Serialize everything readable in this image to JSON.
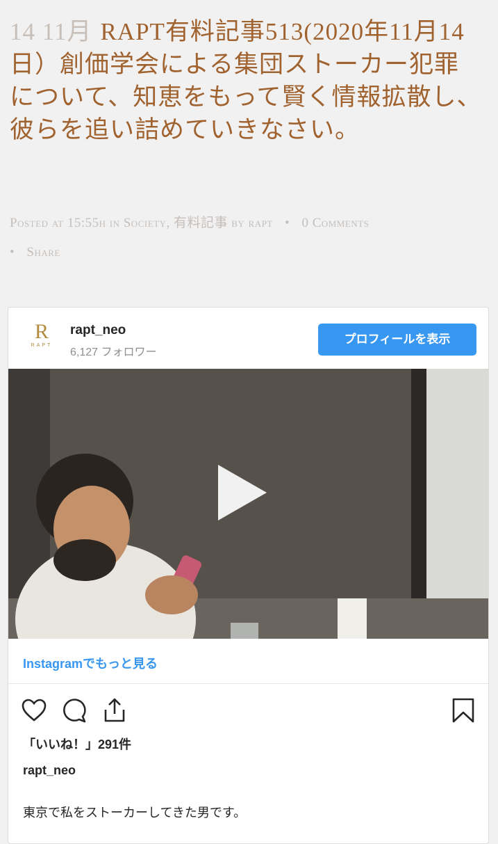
{
  "article": {
    "date": "14 11月",
    "title": "RAPT有料記事513(2020年11月14日）創価学会による集団ストーカー犯罪について、知恵をもって賢く情報拡散し、彼らを追い詰めていきなさい。",
    "meta_prefix": "Posted at 15:55h in",
    "category1": "Society,",
    "category2": "有料記事",
    "by": "by",
    "author": "rapt",
    "comments": "0 Comments",
    "share": "Share"
  },
  "embed": {
    "logo_letter": "R",
    "logo_text": "RAPT",
    "username": "rapt_neo",
    "followers": "6,127 フォロワー",
    "profile_button": "プロフィールを表示",
    "more_link": "Instagramでもっと見る",
    "likes": "「いいね！」291件",
    "post_username": "rapt_neo",
    "caption": "東京で私をストーカーしてきた男です。"
  },
  "colors": {
    "accent": "#a0622f",
    "button": "#3897f0"
  }
}
